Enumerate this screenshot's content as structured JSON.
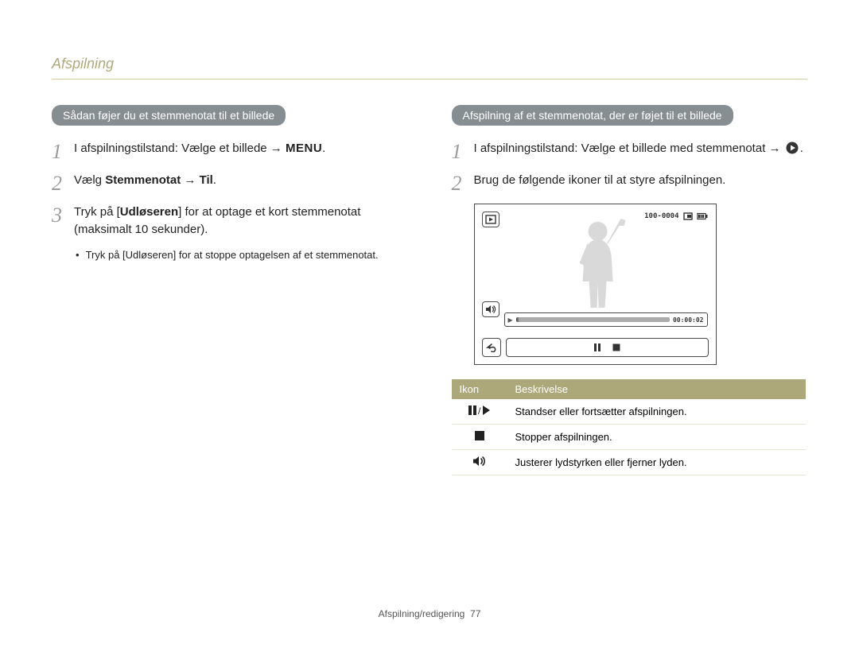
{
  "page": {
    "title": "Afspilning",
    "footer_section": "Afspilning/redigering",
    "footer_page": "77"
  },
  "left": {
    "heading": "Sådan føjer du et stemmenotat til et billede",
    "step1_prefix": "I afspilningstilstand: Vælge et billede → ",
    "menu_label": "MENU",
    "step2_prefix": "Vælg ",
    "step2_bold": "Stemmenotat",
    "step2_arrow": " → ",
    "step2_bold2": "Til",
    "step3_prefix": "Tryk på [",
    "step3_bold": "Udløseren",
    "step3_suffix": "] for at optage et kort stemmenotat (maksimalt 10 sekunder).",
    "bullet_prefix": "Tryk på [",
    "bullet_bold": "Udløseren",
    "bullet_suffix": "] for at stoppe optagelsen af et stemmenotat."
  },
  "right": {
    "heading": "Afspilning af et stemmenotat, der er føjet til et billede",
    "step1": "I afspilningstilstand: Vælge et billede med stemmenotat → ",
    "step2": "Brug de følgende ikoner til at styre afspilningen.",
    "screen": {
      "counter": "100-0004",
      "time": "00:00:02"
    },
    "table": {
      "th_icon": "Ikon",
      "th_desc": "Beskrivelse",
      "row1": "Standser eller fortsætter afspilningen.",
      "row2": "Stopper afspilningen.",
      "row3": "Justerer lydstyrken eller fjerner lyden."
    }
  }
}
